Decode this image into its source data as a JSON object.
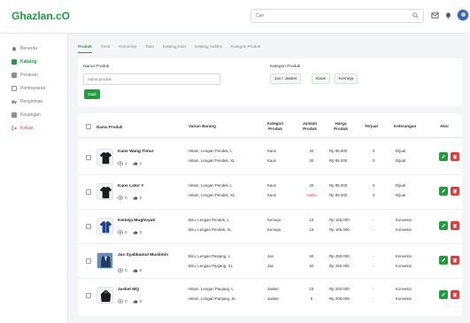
{
  "app": {
    "brand": "Ghazlan.cO"
  },
  "header": {
    "search_placeholder": "Cari"
  },
  "sidebar": {
    "items": [
      {
        "label": "Beranda",
        "icon": "home-icon",
        "active": false
      },
      {
        "label": "Katalog",
        "icon": "catalog-icon",
        "active": true
      },
      {
        "label": "Pesanan",
        "icon": "orders-icon",
        "active": false
      },
      {
        "label": "Pembayaran",
        "icon": "payment-icon",
        "active": false
      },
      {
        "label": "Pengiriman",
        "icon": "shipping-icon",
        "active": false
      },
      {
        "label": "Keuangan",
        "icon": "finance-icon",
        "active": false
      },
      {
        "label": "Keluar",
        "icon": "logout-icon",
        "active": false
      }
    ]
  },
  "tabs": [
    "Produk",
    "Feed",
    "Komentar",
    "Toko",
    "Katalog Kain",
    "Katalog Sablon",
    "Kategori Produk"
  ],
  "filter": {
    "name_label": "Nama Produk",
    "name_placeholder": "nama produk",
    "search_button": "Cari",
    "category_label": "Kategori Produk",
    "categories": [
      "Jas / Jasket",
      "Kaos",
      "Kemeja"
    ]
  },
  "table": {
    "headers": {
      "name": "Nama Produk",
      "variant": "Varian Barang",
      "category": "Kategori Produk",
      "qty": "Jumlah Produk",
      "price": "Harga Produk",
      "sold": "Terjual",
      "note": "Keterangan",
      "action": "Aksi"
    },
    "rows": [
      {
        "name": "Kaos Wang Timur",
        "views": "1",
        "likes": "1",
        "thumb": "tshirt-image",
        "lines": [
          {
            "variant": "Hitam, Lengan Pendek, L",
            "category": "Kaos",
            "qty": "20",
            "price": "Rp 85.000",
            "sold": "0",
            "note": "Dijual",
            "habis": false
          },
          {
            "variant": "Hitam, Lengan Pendek, XL",
            "category": "Kaos",
            "qty": "20",
            "price": "Rp 85.000",
            "sold": "0",
            "note": "Dijual",
            "habis": false
          }
        ]
      },
      {
        "name": "Kaos Lator Y",
        "views": "0",
        "likes": "0",
        "thumb": "tshirt-image",
        "lines": [
          {
            "variant": "Hitam, Lengan Pendek, L",
            "category": "Kaos",
            "qty": "20",
            "price": "Rp 85.000",
            "sold": "0",
            "note": "Dijual",
            "habis": false
          },
          {
            "variant": "Hitam, Lengan Pendek, XL",
            "category": "Kaos",
            "qty": "Habis",
            "price": "Rp 85.000",
            "sold": "0",
            "note": "Dijual",
            "habis": true
          }
        ]
      },
      {
        "name": "Kemeja Mughoyah",
        "views": "0",
        "likes": "0",
        "thumb": "shirt-image",
        "lines": [
          {
            "variant": "Biru, Lengan Pendek, L",
            "category": "Kemeja",
            "qty": "15",
            "price": "Rp 155.000",
            "sold": "-",
            "note": "Konveksi",
            "habis": false
          },
          {
            "variant": "Biru, Lengan Pendek, XL",
            "category": "Kemeja",
            "qty": "15",
            "price": "Rp 155.000",
            "sold": "-",
            "note": "Konveksi",
            "habis": false
          }
        ]
      },
      {
        "name": "Jas Syabbamul Muslimin",
        "views": "0",
        "likes": "0",
        "thumb": "jacket-image",
        "lines": [
          {
            "variant": "Biru, Lengan Panjang, L",
            "category": "Jas",
            "qty": "50",
            "price": "Rp 250.000",
            "sold": "-",
            "note": "Konveksi",
            "habis": false
          },
          {
            "variant": "Biru, Lengan Panjang, XL",
            "category": "Jas",
            "qty": "50",
            "price": "Rp 250.000",
            "sold": "-",
            "note": "Konveksi",
            "habis": false
          }
        ]
      },
      {
        "name": "Jasket MQ",
        "views": "0",
        "likes": "0",
        "thumb": "hoodie-image",
        "lines": [
          {
            "variant": "Hitam, Lengan Panjang, L",
            "category": "Jasket",
            "qty": "15",
            "price": "Rp 200.000",
            "sold": "-",
            "note": "Konveksi",
            "habis": false
          },
          {
            "variant": "Hitam, Lengan Panjang, XL",
            "category": "Jasket",
            "qty": "5",
            "price": "Rp 200.000",
            "sold": "-",
            "note": "Konveksi",
            "habis": false
          }
        ]
      }
    ]
  },
  "colors": {
    "brand": "#1f9d3f",
    "danger": "#e23b3b"
  }
}
